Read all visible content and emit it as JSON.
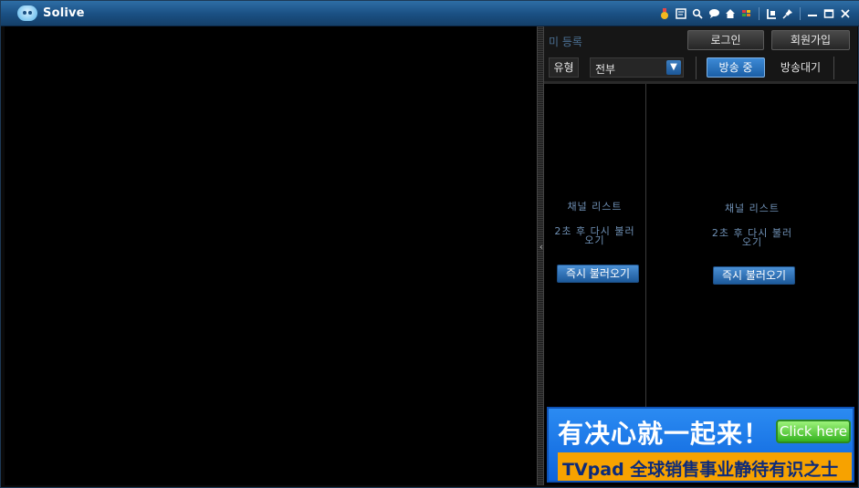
{
  "window": {
    "title": "Solive",
    "title_icons": [
      "medal-icon",
      "notes-icon",
      "search-icon",
      "chat-icon",
      "home-icon",
      "palette-icon",
      "layout-icon",
      "pin-icon",
      "minimize-icon",
      "maximize-icon",
      "close-icon"
    ]
  },
  "account": {
    "status": "미 등록",
    "login_label": "로그인",
    "join_label": "회원가입"
  },
  "filter": {
    "type_label": "유형",
    "type_selected": "전부",
    "tab_live": "방송 중",
    "tab_waiting": "방송대기"
  },
  "channel_columns": [
    {
      "title": "채널 리스트",
      "message_line1": "2초 후 다시 불러",
      "message_line2": "오기",
      "button": "즉시 불러오기"
    },
    {
      "title": "채널 리스트",
      "message_line1": "2초 후 다시 불러",
      "message_line2": "오기",
      "button": "즉시 불러오기"
    }
  ],
  "ad": {
    "headline": "有决心就一起来！",
    "cta": "Click here",
    "tagline": "TVpad 全球销售事业静待有识之士"
  },
  "colors": {
    "titlebar": "#1a4f82",
    "accent_blue": "#1b5fa6",
    "ad_orange": "#f7a200",
    "ad_green": "#35b31f"
  }
}
